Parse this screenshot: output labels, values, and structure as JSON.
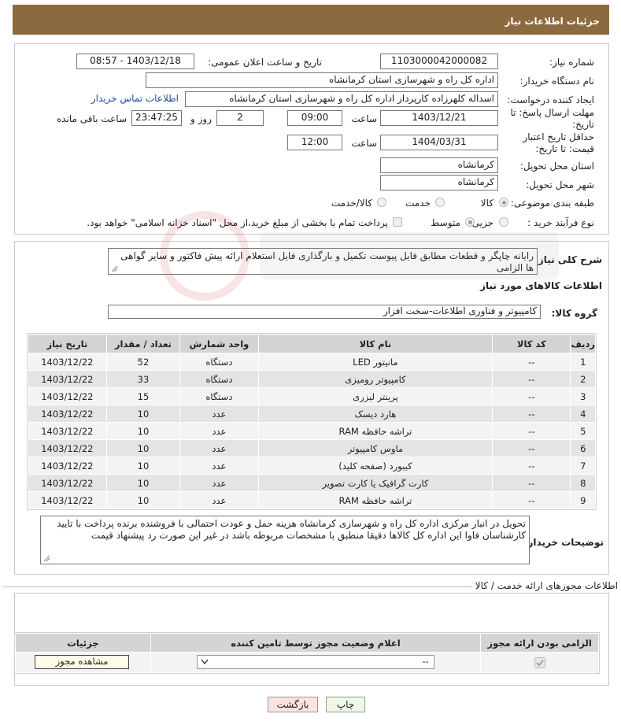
{
  "header": {
    "title": "جزئیات اطلاعات نیاز"
  },
  "form": {
    "need_number_label": "شماره نیاز:",
    "need_number": "1103000042000082",
    "announce_label": "تاریخ و ساعت اعلان عمومی:",
    "announce_value": "1403/12/18 - 08:57",
    "buyer_org_label": "نام دستگاه خریدار:",
    "buyer_org": "اداره کل راه و شهرسازی استان کرمانشاه",
    "creator_label": "ایجاد کننده درخواست:",
    "creator": "اسداله کلهرزاده کارپرداز اداره کل راه و شهرسازی استان کرمانشاه",
    "contact_link": "اطلاعات تماس خریدار",
    "reply_deadline_label": "مهلت ارسال پاسخ: تا تاریخ:",
    "reply_date": "1403/12/21",
    "time_label": "ساعت",
    "reply_time": "09:00",
    "days_count": "2",
    "days_label": "روز و",
    "remaining_time": "23:47:25",
    "remaining_label": "ساعت باقی مانده",
    "price_validity_label": "حداقل تاریخ اعتبار قیمت: تا تاریخ:",
    "price_date": "1404/03/31",
    "price_time": "12:00",
    "province_label": "استان محل تحویل:",
    "province": "کرمانشاه",
    "city_label": "شهر محل تحویل:",
    "city": "کرمانشاه",
    "category_label": "طبقه بندی موضوعی:",
    "category_options": [
      "کالا",
      "خدمت",
      "کالا/خدمت"
    ],
    "process_label": "نوع فرآیند خرید :",
    "process_options": [
      "جزیی",
      "متوسط"
    ],
    "payment_note": "پرداخت تمام یا بخشی از مبلغ خرید،از محل \"اسناد خزانه اسلامی\" خواهد بود."
  },
  "details": {
    "description_label": "شرح کلی نیاز:",
    "description": "رایانه چاپگر و قطعات مطابق فایل پیوست تکمیل و بارگذاری فایل استعلام ارائه پیش فاکتور و سایر گواهی ها الزامی",
    "goods_info_title": "اطلاعات کالاهای مورد نیاز",
    "goods_group_label": "گروه کالا:",
    "goods_group": "کامپیوتر و فناوری اطلاعات-سخت افزار",
    "table": {
      "headers": [
        "ردیف",
        "کد کالا",
        "نام کالا",
        "واحد شمارش",
        "تعداد / مقدار",
        "تاریخ نیاز"
      ],
      "rows": [
        [
          "1",
          "--",
          "مانیتور LED",
          "دستگاه",
          "52",
          "1403/12/22"
        ],
        [
          "2",
          "--",
          "کامپیوتر رومیزی",
          "دستگاه",
          "33",
          "1403/12/22"
        ],
        [
          "3",
          "--",
          "پرینتر لیزری",
          "دستگاه",
          "15",
          "1403/12/22"
        ],
        [
          "4",
          "--",
          "هارد دیسک",
          "عدد",
          "10",
          "1403/12/22"
        ],
        [
          "5",
          "--",
          "تراشه حافظه RAM",
          "عدد",
          "10",
          "1403/12/22"
        ],
        [
          "6",
          "--",
          "ماوس کامپیوتر",
          "عدد",
          "10",
          "1403/12/22"
        ],
        [
          "7",
          "--",
          "کیبورد (صفحه کلید)",
          "عدد",
          "10",
          "1403/12/22"
        ],
        [
          "8",
          "--",
          "کارت گرافیک یا کارت تصویر",
          "عدد",
          "10",
          "1403/12/22"
        ],
        [
          "9",
          "--",
          "تراشه حافظه RAM",
          "عدد",
          "10",
          "1403/12/22"
        ]
      ]
    },
    "buyer_notes_label": "توضیحات خریدار:",
    "buyer_notes": "تحویل در انبار مرکزی اداره کل راه و شهرسازی کرمانشاه هزینه حمل و عودت احتمالی با فروشنده برنده پرداخت با تایید کارشناسان فاوا این اداره کل کالاها دقیقا منطبق با مشخصات مربوطه باشد در غیر این صورت رد پیشنهاد قیمت"
  },
  "permits": {
    "title": "اطلاعات مجوزهای ارائه خدمت / کالا",
    "headers": [
      "الزامی بودن ارائه مجوز",
      "اعلام وضعیت مجوز توسط تامین کننده",
      "جزئیات"
    ],
    "select_value": "--",
    "view_button": "مشاهده مجوز"
  },
  "buttons": {
    "print": "چاپ",
    "back": "بازگشت"
  }
}
